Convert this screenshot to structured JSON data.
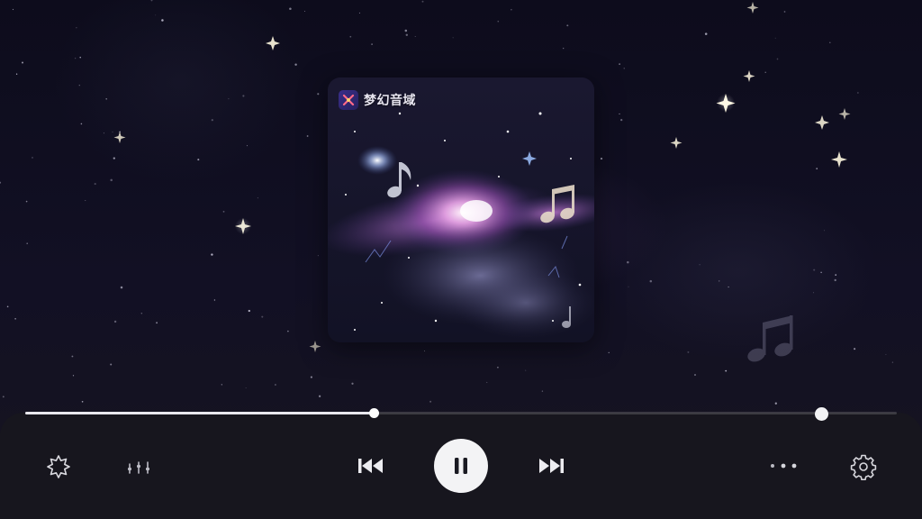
{
  "app": {
    "name": "梦幻音域",
    "logo_icon": "app-logo-icon"
  },
  "player": {
    "state": "playing",
    "progress_fraction": 0.4,
    "volume_fraction": 0.92
  },
  "controls": {
    "left": [
      {
        "name": "effects-button",
        "icon": "sparkle-gear-icon"
      },
      {
        "name": "equalizer-button",
        "icon": "equalizer-icon"
      }
    ],
    "center": [
      {
        "name": "prev-button",
        "icon": "skip-previous-icon"
      },
      {
        "name": "play-pause-button",
        "icon": "pause-icon"
      },
      {
        "name": "next-button",
        "icon": "skip-next-icon"
      }
    ],
    "right": [
      {
        "name": "more-button",
        "icon": "more-dots-icon"
      },
      {
        "name": "settings-button",
        "icon": "gear-icon"
      }
    ]
  },
  "colors": {
    "background": "#0c0b18",
    "control_bar": "#18171e",
    "progress_fill": "#e9e8ee",
    "nebula_accent": "#b46ad2",
    "play_button": "#f3f3f5"
  }
}
